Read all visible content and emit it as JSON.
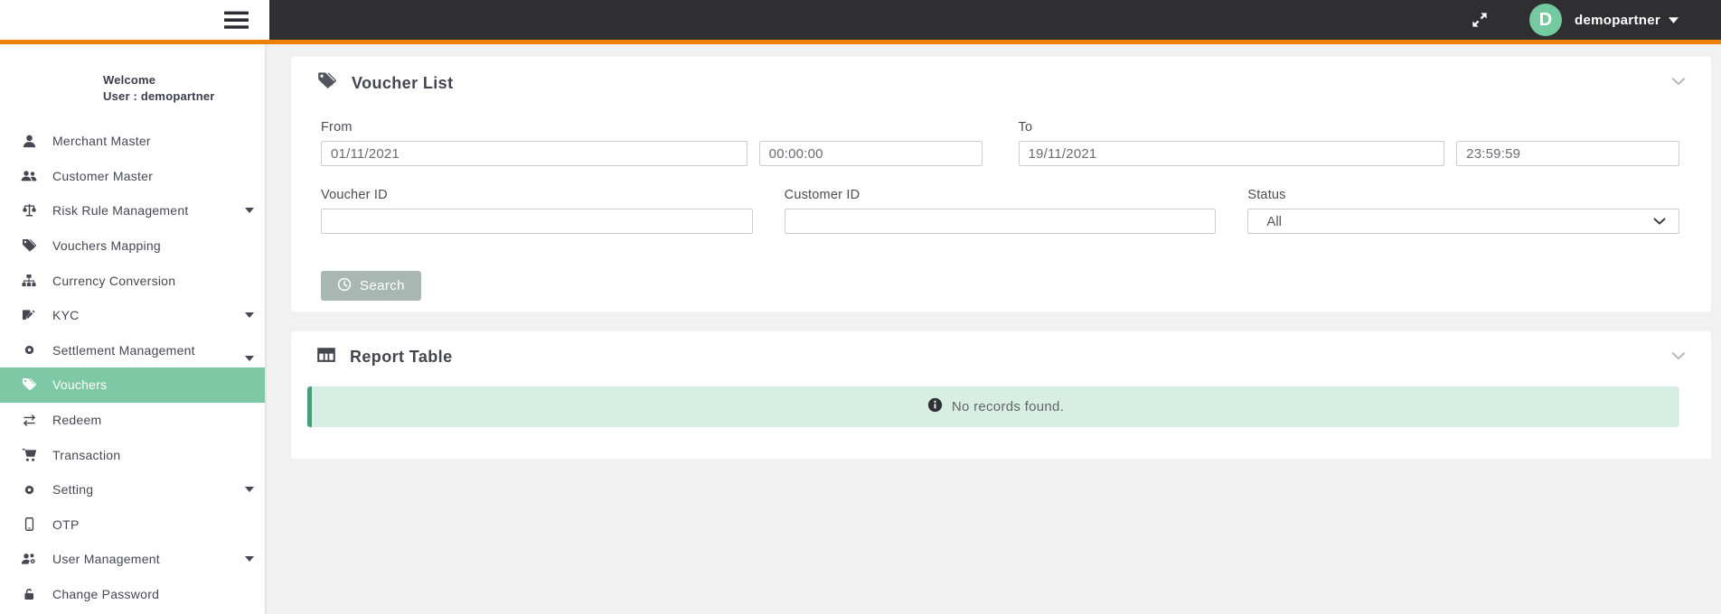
{
  "topbar": {
    "user": {
      "initial": "D",
      "name": "demopartner"
    }
  },
  "sidebar": {
    "welcome_line1": "Welcome",
    "welcome_line2": "User : demopartner",
    "items": [
      {
        "label": "Merchant Master",
        "icon": "user-icon",
        "caret": false,
        "active": false
      },
      {
        "label": "Customer Master",
        "icon": "users-icon",
        "caret": false,
        "active": false
      },
      {
        "label": "Risk Rule Management",
        "icon": "balance-scale-icon",
        "caret": true,
        "active": false
      },
      {
        "label": "Vouchers Mapping",
        "icon": "tags-icon",
        "caret": false,
        "active": false
      },
      {
        "label": "Currency Conversion",
        "icon": "sitemap-icon",
        "caret": false,
        "active": false
      },
      {
        "label": "KYC",
        "icon": "file-signature-icon",
        "caret": true,
        "active": false
      },
      {
        "label": "Settlement Management",
        "icon": "gear-icon",
        "caret": true,
        "active": false
      },
      {
        "label": "Vouchers",
        "icon": "tags-icon",
        "caret": false,
        "active": true
      },
      {
        "label": "Redeem",
        "icon": "exchange-icon",
        "caret": false,
        "active": false
      },
      {
        "label": "Transaction",
        "icon": "cart-icon",
        "caret": false,
        "active": false
      },
      {
        "label": "Setting",
        "icon": "gear-icon",
        "caret": true,
        "active": false
      },
      {
        "label": "OTP",
        "icon": "mobile-icon",
        "caret": false,
        "active": false
      },
      {
        "label": "User Management",
        "icon": "users-gear-icon",
        "caret": true,
        "active": false
      },
      {
        "label": "Change Password",
        "icon": "lock-open-icon",
        "caret": false,
        "active": false
      }
    ]
  },
  "voucher_list": {
    "title": "Voucher List",
    "from_label": "From",
    "from_date": "01/11/2021",
    "from_time": "00:00:00",
    "to_label": "To",
    "to_date": "19/11/2021",
    "to_time": "23:59:59",
    "voucher_id_label": "Voucher ID",
    "voucher_id_value": "",
    "customer_id_label": "Customer ID",
    "customer_id_value": "",
    "status_label": "Status",
    "status_value": "All",
    "search_label": "Search"
  },
  "report_table": {
    "title": "Report Table",
    "empty_message": "No records found."
  },
  "colors": {
    "accent_orange": "#ee8206",
    "topbar_bg": "#2f2f31",
    "active_green": "#7ec8a5",
    "avatar_green": "#74c9a1",
    "alert_bg": "#d7efe3",
    "alert_border": "#4a9c77",
    "search_button": "#a9b7b2"
  }
}
